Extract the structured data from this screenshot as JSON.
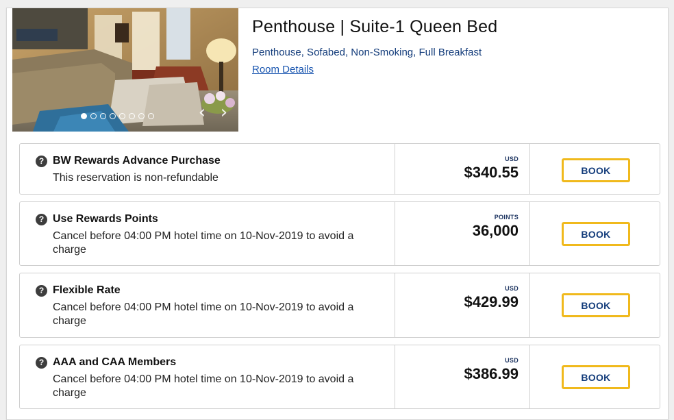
{
  "room": {
    "title": "Penthouse | Suite-1 Queen Bed",
    "features": "Penthouse, Sofabed, Non-Smoking, Full Breakfast",
    "details_link": "Room Details",
    "gallery": {
      "total_images": 8,
      "active_index": 0,
      "prev_icon": "chevron-left-icon",
      "next_icon": "chevron-right-icon"
    }
  },
  "rates": [
    {
      "name": "BW Rewards Advance Purchase",
      "description": "This reservation is non-refundable",
      "currency": "USD",
      "amount": "$340.55",
      "book_label": "BOOK"
    },
    {
      "name": "Use Rewards Points",
      "description": "Cancel before 04:00 PM hotel time on 10-Nov-2019 to avoid a charge",
      "currency": "POINTS",
      "amount": "36,000",
      "book_label": "BOOK"
    },
    {
      "name": "Flexible Rate",
      "description": "Cancel before 04:00 PM hotel time on 10-Nov-2019 to avoid a charge",
      "currency": "USD",
      "amount": "$429.99",
      "book_label": "BOOK"
    },
    {
      "name": "AAA and CAA Members",
      "description": "Cancel before 04:00 PM hotel time on 10-Nov-2019 to avoid a charge",
      "currency": "USD",
      "amount": "$386.99",
      "book_label": "BOOK"
    }
  ],
  "icons": {
    "help": "?",
    "help_icon_name": "question-circle-icon"
  },
  "colors": {
    "accent_gold": "#f0b91c",
    "brand_navy": "#123b7a",
    "link_blue": "#1a56b0"
  }
}
